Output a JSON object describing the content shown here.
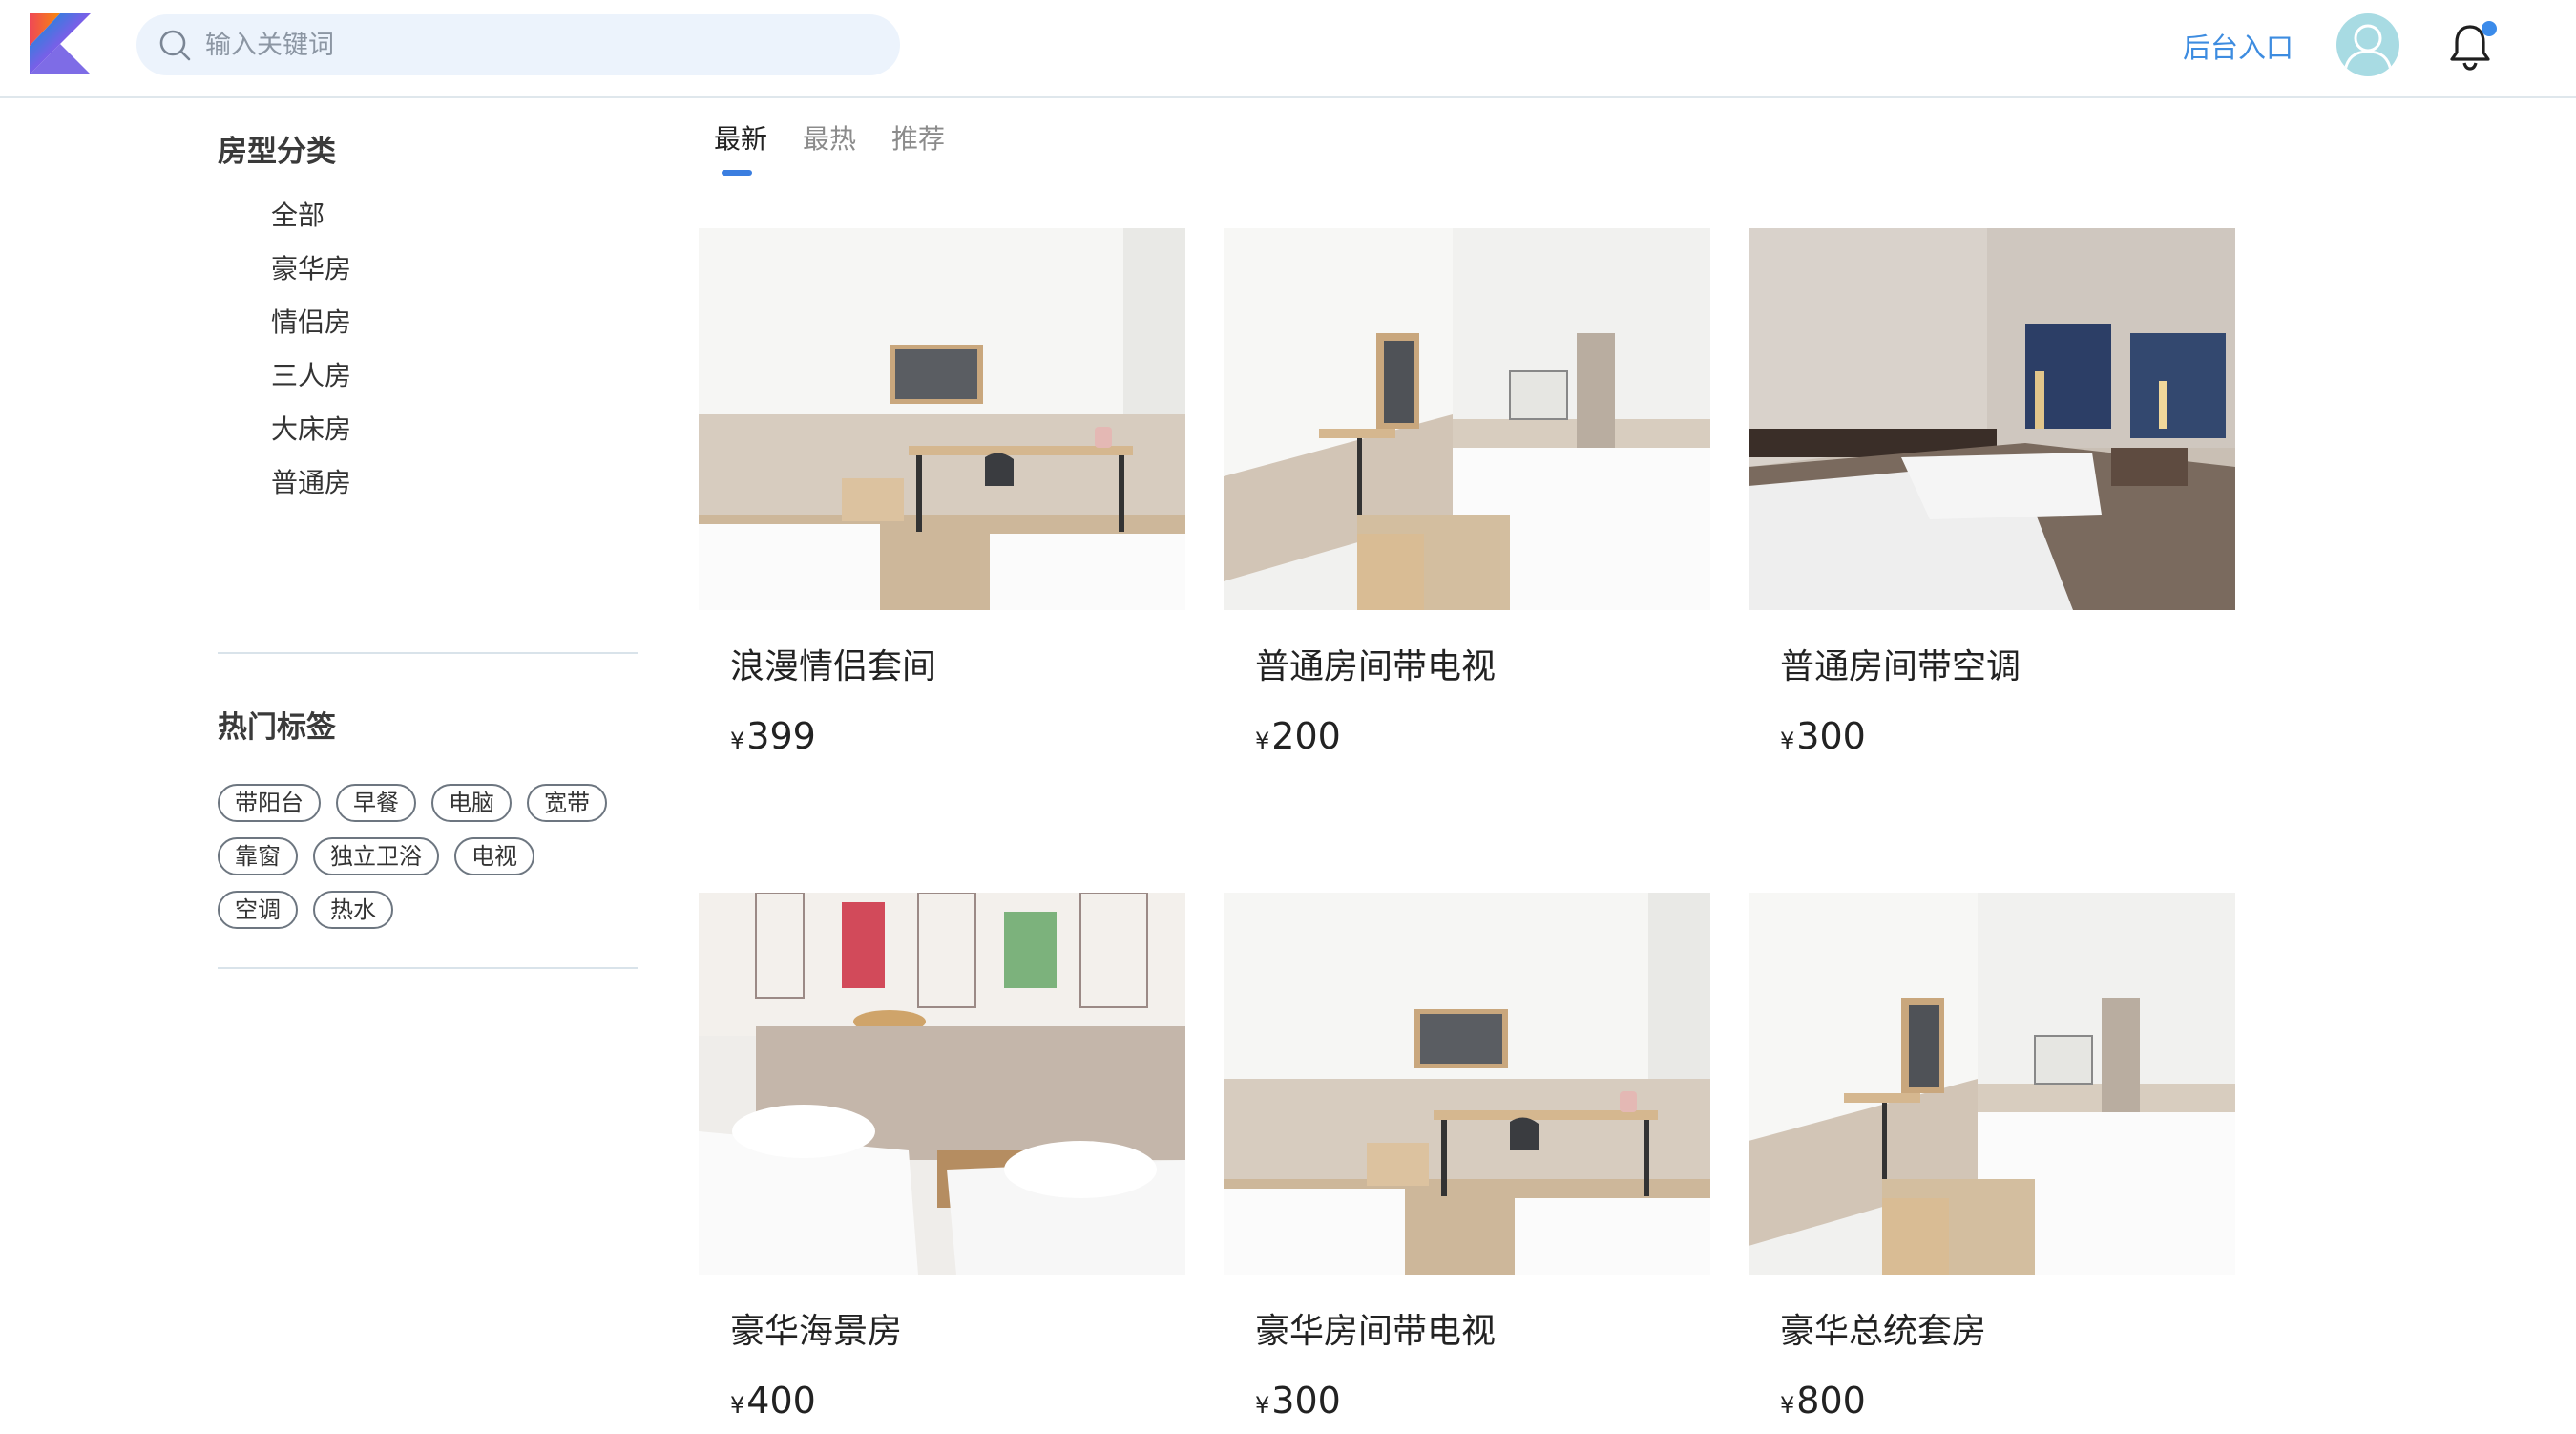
{
  "header": {
    "search": {
      "placeholder": "输入关键词",
      "value": ""
    },
    "admin_link": "后台入口",
    "icons": {
      "logo": "kotlin-logo-icon",
      "search": "search-icon",
      "avatar": "user-avatar-icon",
      "notifications": "bell-icon"
    },
    "notification_unread": true
  },
  "sidebar": {
    "room_types_title": "房型分类",
    "room_types": [
      "全部",
      "豪华房",
      "情侣房",
      "三人房",
      "大床房",
      "普通房"
    ],
    "hot_tags_title": "热门标签",
    "tag_rows": [
      [
        "带阳台",
        "早餐",
        "电脑",
        "宽带"
      ],
      [
        "靠窗",
        "独立卫浴",
        "电视"
      ],
      [
        "空调",
        "热水"
      ]
    ]
  },
  "tabs": [
    {
      "label": "最新",
      "active": true
    },
    {
      "label": "最热",
      "active": false
    },
    {
      "label": "推荐",
      "active": false
    }
  ],
  "currency_symbol": "¥",
  "rooms": [
    {
      "name": "浪漫情侣套间",
      "price": "399"
    },
    {
      "name": "普通房间带电视",
      "price": "200"
    },
    {
      "name": "普通房间带空调",
      "price": "300"
    },
    {
      "name": "豪华海景房",
      "price": "400"
    },
    {
      "name": "豪华房间带电视",
      "price": "300"
    },
    {
      "name": "豪华总统套房",
      "price": "800"
    }
  ],
  "colors": {
    "accent": "#3b7ee0",
    "admin_link": "#3d8ce0",
    "search_bg": "#ecf3fc",
    "avatar_bg": "#a8dbe3",
    "divider": "#d9e3ea"
  }
}
